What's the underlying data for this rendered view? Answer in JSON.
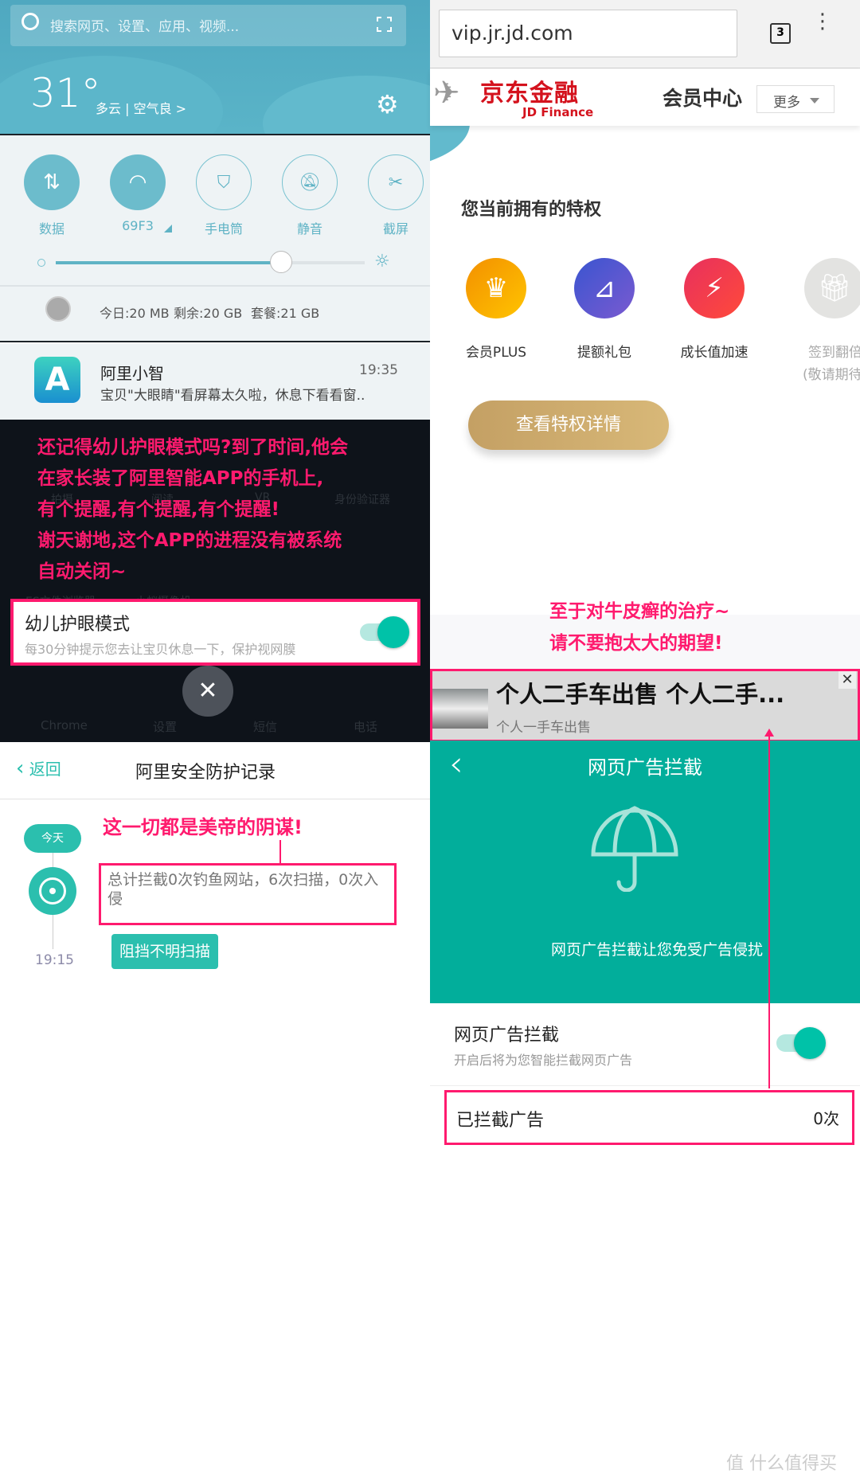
{
  "notification_shade": {
    "search_placeholder": "搜索网页、设置、应用、视频...",
    "temperature": "31°",
    "weather_desc": "多云 | 空气良 >",
    "quick_settings": [
      {
        "label": "数据",
        "icon": "data-arrows-icon",
        "on": true
      },
      {
        "label": "69F3",
        "icon": "wifi-icon",
        "on": true
      },
      {
        "label": "手电筒",
        "icon": "flashlight-icon",
        "on": false
      },
      {
        "label": "静音",
        "icon": "bell-off-icon",
        "on": false
      },
      {
        "label": "截屏",
        "icon": "screenshot-icon",
        "on": false
      }
    ],
    "brightness_percent": 73,
    "data_today": "今日:20 MB",
    "data_remaining": "剩余:20 GB",
    "data_plan": "套餐:21 GB",
    "notification": {
      "title": "阿里小智",
      "time": "19:35",
      "body": "宝贝\"大眼睛\"看屏幕太久啦，休息下看看窗.."
    }
  },
  "annotation_left_top": [
    "还记得幼儿护眼模式吗?到了时间,他会",
    "在家长装了阿里智能APP的手机上,",
    "有个提醒,有个提醒,有个提醒!",
    "谢天谢地,这个APP的进程没有被系统",
    "自动关闭~"
  ],
  "home_ghost_labels": [
    "拍摄",
    "阅读",
    "VR",
    "身份验证器",
    "ES文件浏览器",
    "小蚁摄像机"
  ],
  "eye_mode": {
    "title": "幼儿护眼模式",
    "subtitle": "每30分钟提示您去让宝贝休息一下，保护视网膜",
    "enabled": true
  },
  "dock": [
    "Chrome",
    "设置",
    "短信",
    "电话"
  ],
  "security_log": {
    "back": "返回",
    "title": "阿里安全防护记录",
    "today": "今天",
    "annotation": "这一切都是美帝的阴谋!",
    "summary": "总计拦截0次钓鱼网站，6次扫描，0次入侵",
    "event": "阻挡不明扫描",
    "time": "19:15"
  },
  "browser": {
    "url": "vip.jr.jd.com",
    "tab_count": "3"
  },
  "jd": {
    "logo_cn": "京东金融",
    "logo_en": "JD Finance",
    "title": "会员中心",
    "more": "更多",
    "section_title": "您当前拥有的特权",
    "privileges": [
      {
        "label": "会员PLUS",
        "icon": "crown-icon",
        "color": "#f7a10a"
      },
      {
        "label": "提额礼包",
        "icon": "credit-up-icon",
        "color": "#5a5ad6"
      },
      {
        "label": "成长值加速",
        "icon": "lightning-icon",
        "color": "#f03a55"
      },
      {
        "label": "签到翻倍",
        "sub": "(敬请期待",
        "icon": "gift-icon",
        "color": "#e0e0e0"
      }
    ],
    "details_button": "查看特权详情"
  },
  "annotation_right": [
    "至于对牛皮癣的治疗~",
    "请不要抱太大的期望!"
  ],
  "ad": {
    "title": "个人二手车出售 个人二手...",
    "subtitle": "个人一手车出售"
  },
  "adblock": {
    "title": "网页广告拦截",
    "tagline": "网页广告拦截让您免受广告侵扰",
    "setting_title": "网页广告拦截",
    "setting_sub": "开启后将为您智能拦截网页广告",
    "enabled": true,
    "blocked_label": "已拦截广告",
    "blocked_count": "0次"
  },
  "watermark": "值 什么值得买",
  "colors": {
    "annotation": "#ff1a6e",
    "teal": "#02ae9b",
    "accent": "#00c2a8",
    "weather": "#55afc4"
  }
}
